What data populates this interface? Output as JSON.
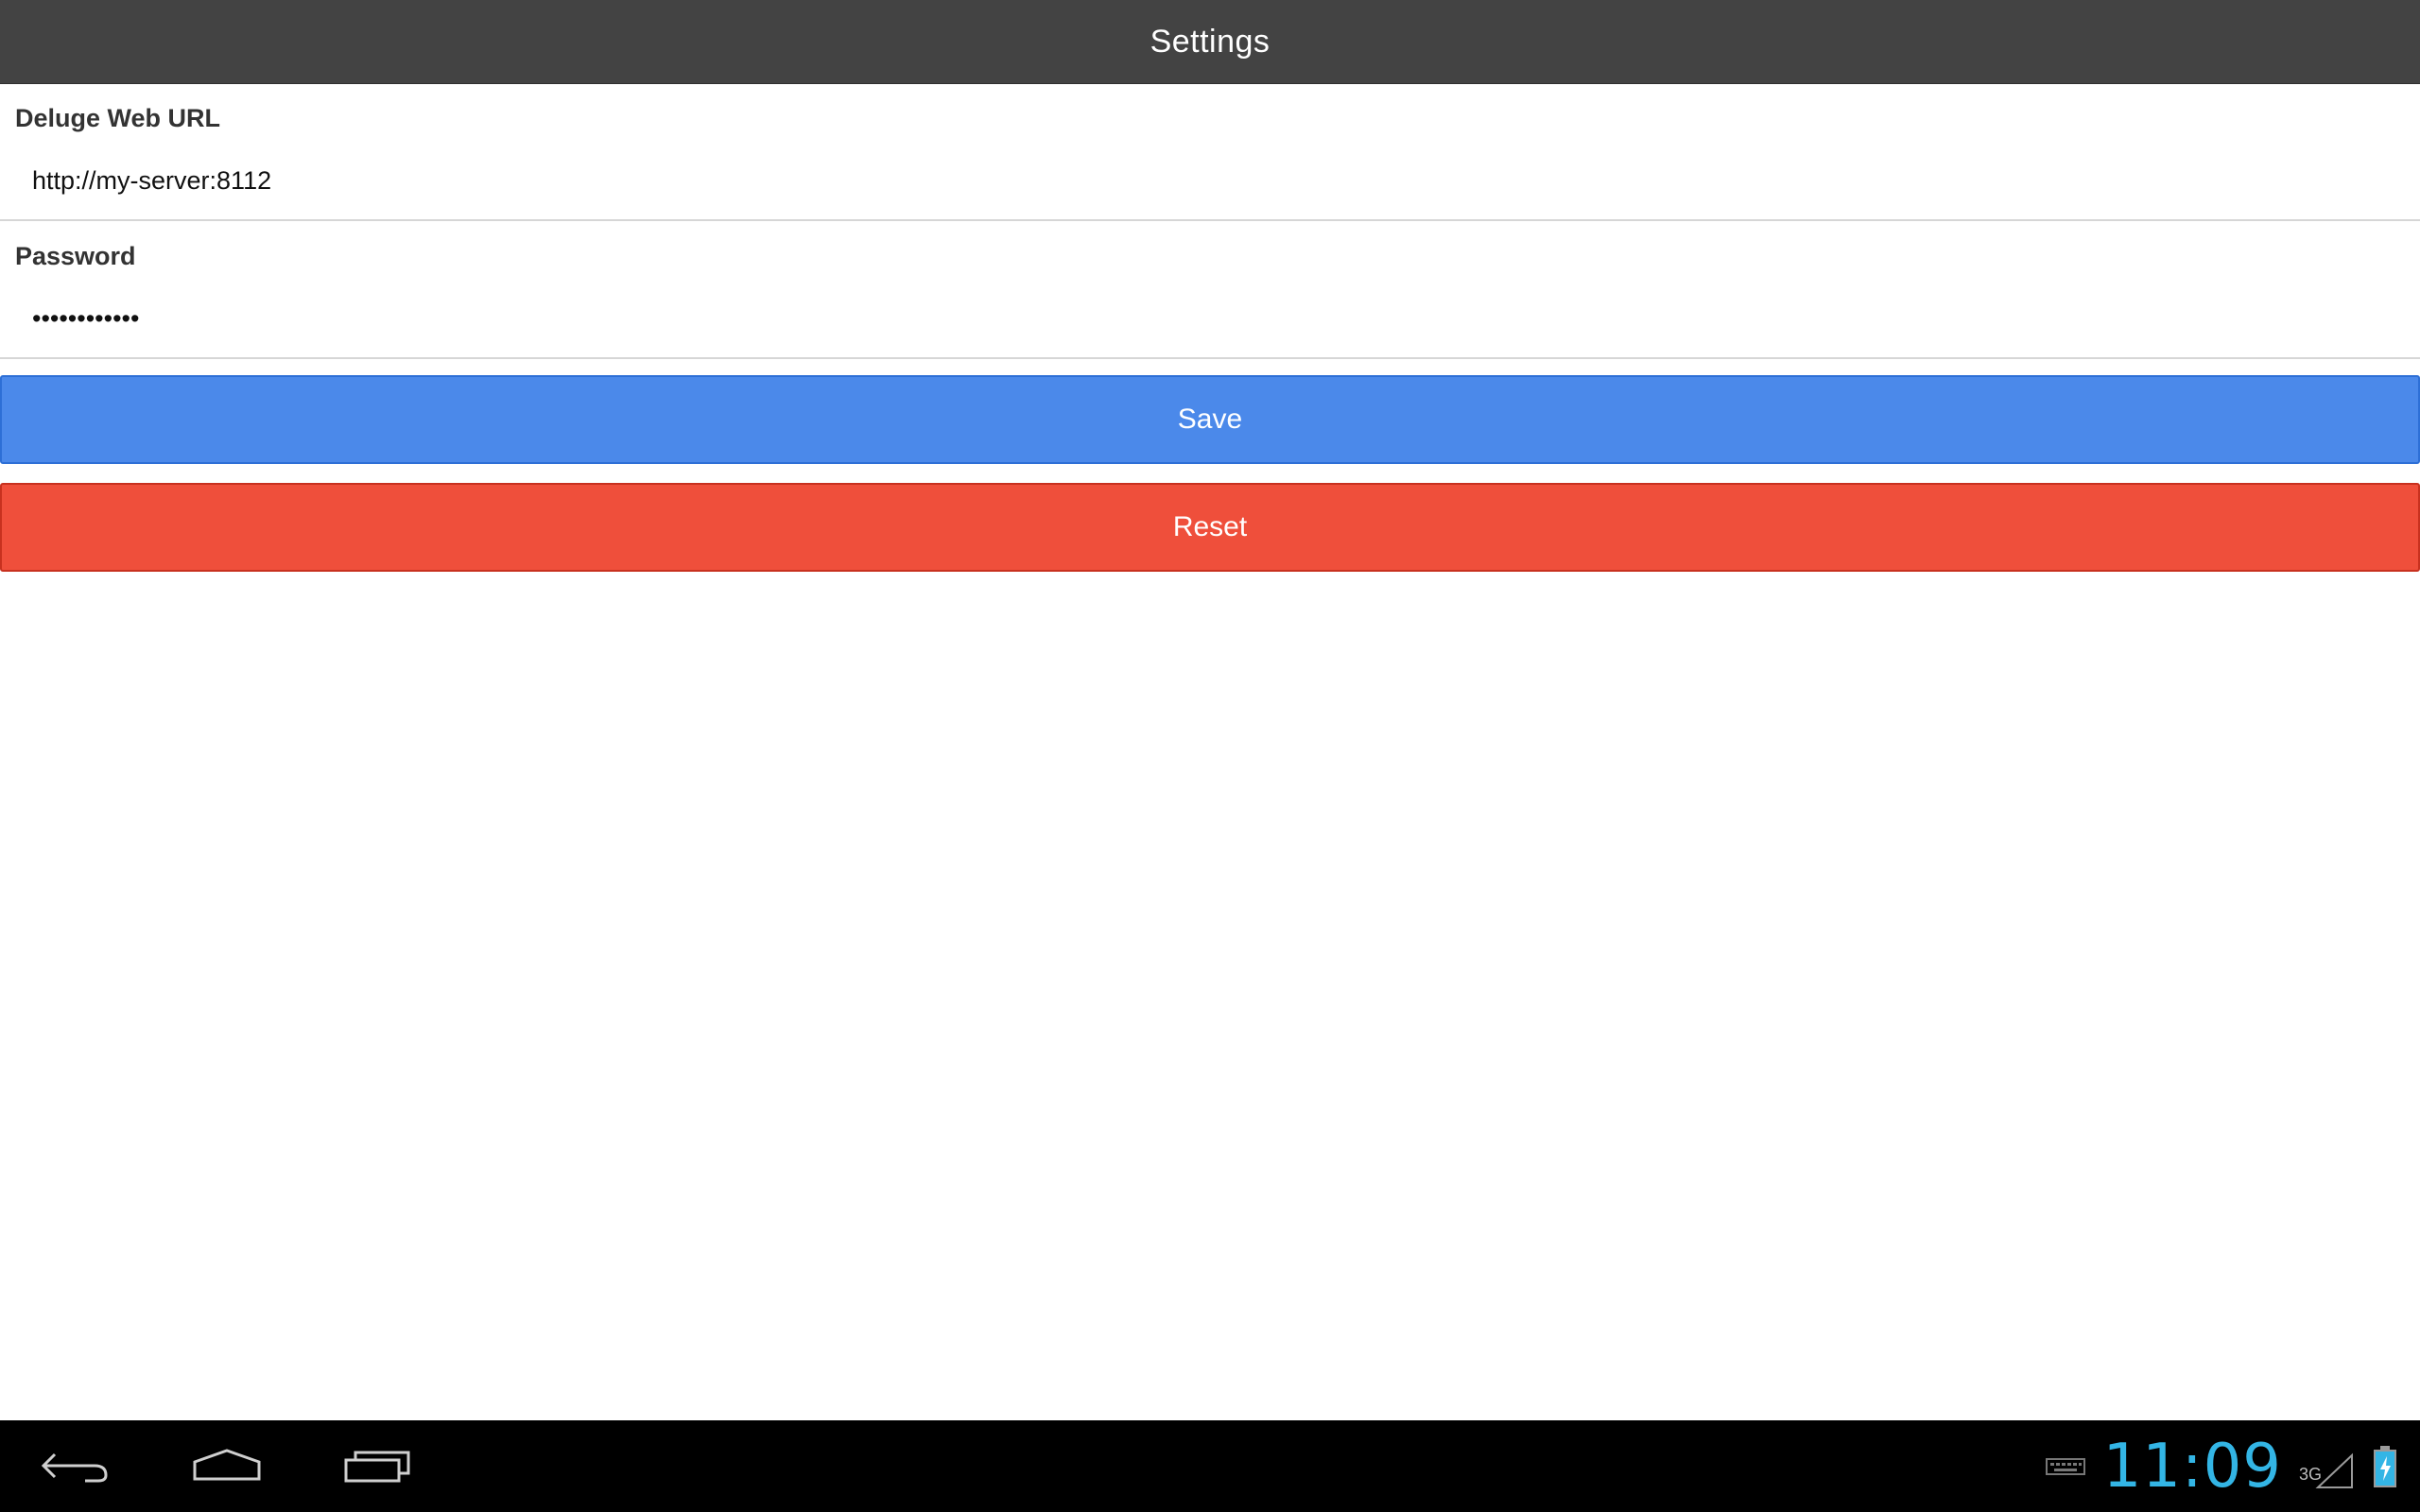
{
  "header": {
    "title": "Settings"
  },
  "form": {
    "url_label": "Deluge Web URL",
    "url_value": "http://my-server:8112",
    "password_label": "Password",
    "password_value": "••••••••••••"
  },
  "actions": {
    "save_label": "Save",
    "reset_label": "Reset"
  },
  "system_bar": {
    "time": "11:09",
    "network_type": "3G",
    "icons": [
      "back-icon",
      "home-icon",
      "recent-apps-icon",
      "keyboard-icon",
      "signal-icon",
      "battery-charging-icon"
    ]
  },
  "colors": {
    "header_bg": "#434343",
    "save_bg": "#4b89ea",
    "reset_bg": "#ef4f3b",
    "clock": "#33b5e5",
    "nav_bg": "#000000"
  }
}
